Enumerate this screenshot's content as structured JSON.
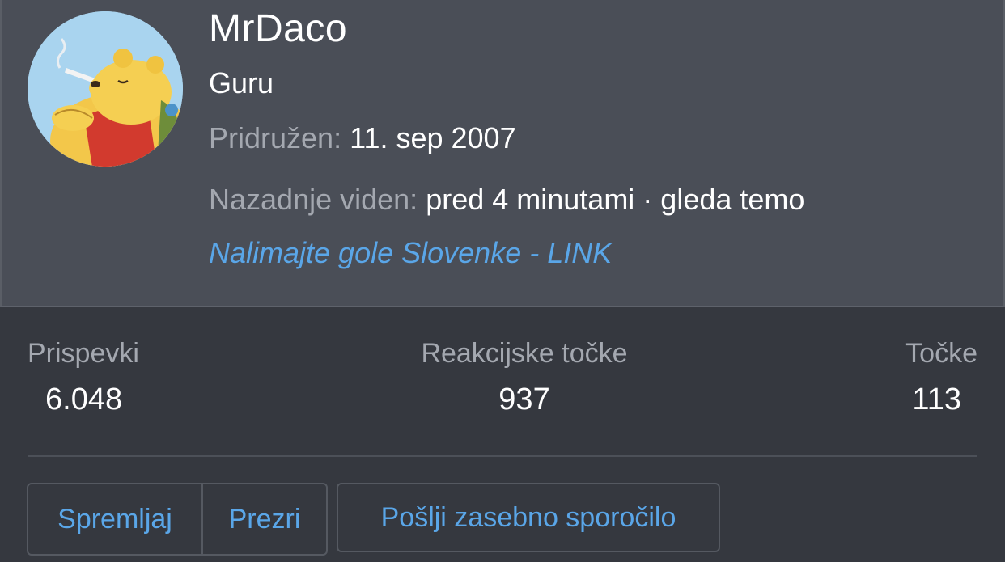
{
  "profile": {
    "username": "MrDaco",
    "user_title": "Guru",
    "joined_label": "Pridružen:",
    "joined_value": "11. sep 2007",
    "last_seen_label": "Nazadnje viden:",
    "last_seen_value": "pred 4 minutami · gleda temo",
    "signature_link": "Nalimajte gole Slovenke - LINK",
    "avatar_icon": "winnie-the-pooh-avatar"
  },
  "stats": [
    {
      "label": "Prispevki",
      "value": "6.048"
    },
    {
      "label": "Reakcijske točke",
      "value": "937"
    },
    {
      "label": "Točke",
      "value": "113"
    }
  ],
  "actions": {
    "follow_label": "Spremljaj",
    "ignore_label": "Prezri",
    "message_label": "Pošlji zasebno sporočilo"
  },
  "colors": {
    "header_bg": "#4a4e57",
    "body_bg": "#35383f",
    "link": "#5aa6e8",
    "muted_label": "#a4a8b0",
    "text": "#ffffff"
  }
}
